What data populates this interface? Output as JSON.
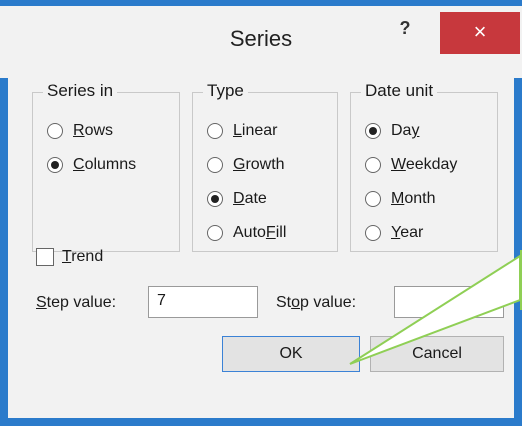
{
  "window": {
    "title": "Series",
    "help_label": "?",
    "close_label": "×"
  },
  "series_in": {
    "title": "Series in",
    "options": [
      {
        "pre": "",
        "u": "R",
        "post": "ows",
        "selected": false
      },
      {
        "pre": "",
        "u": "C",
        "post": "olumns",
        "selected": true
      }
    ]
  },
  "type": {
    "title": "Type",
    "options": [
      {
        "pre": "",
        "u": "L",
        "post": "inear",
        "selected": false
      },
      {
        "pre": "",
        "u": "G",
        "post": "rowth",
        "selected": false
      },
      {
        "pre": "",
        "u": "D",
        "post": "ate",
        "selected": true
      },
      {
        "pre": "Auto",
        "u": "F",
        "post": "ill",
        "selected": false
      }
    ]
  },
  "date_unit": {
    "title": "Date unit",
    "options": [
      {
        "pre": "Da",
        "u": "y",
        "post": "",
        "selected": true
      },
      {
        "pre": "",
        "u": "W",
        "post": "eekday",
        "selected": false
      },
      {
        "pre": "",
        "u": "M",
        "post": "onth",
        "selected": false
      },
      {
        "pre": "",
        "u": "Y",
        "post": "ear",
        "selected": false
      }
    ]
  },
  "trend": {
    "pre": "",
    "u": "T",
    "post": "rend",
    "checked": false
  },
  "step": {
    "pre": "",
    "u": "S",
    "post": "tep value:",
    "value": "7"
  },
  "stop": {
    "pre": "St",
    "u": "o",
    "post": "p value:",
    "value": ""
  },
  "buttons": {
    "ok": "OK",
    "cancel": "Cancel"
  },
  "colors": {
    "title_bar_accent": "#2b7bcb",
    "close_button": "#c7383d",
    "callout": "#8fcf55"
  }
}
